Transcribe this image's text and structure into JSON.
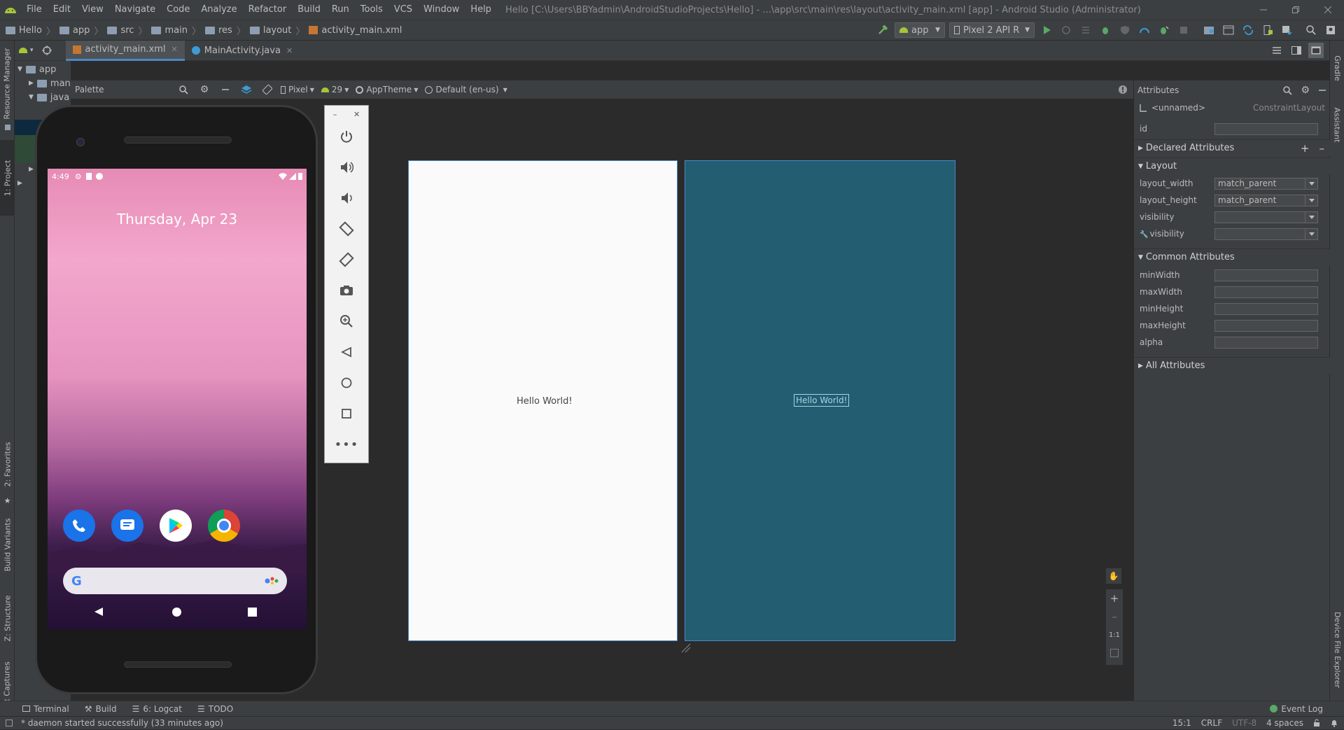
{
  "menubar": {
    "items": [
      "File",
      "Edit",
      "View",
      "Navigate",
      "Code",
      "Analyze",
      "Refactor",
      "Build",
      "Run",
      "Tools",
      "VCS",
      "Window",
      "Help"
    ],
    "title": "Hello [C:\\Users\\BBYadmin\\AndroidStudioProjects\\Hello] - ...\\app\\src\\main\\res\\layout\\activity_main.xml [app] - Android Studio (Administrator)"
  },
  "breadcrumb": [
    "Hello",
    "app",
    "src",
    "main",
    "res",
    "layout",
    "activity_main.xml"
  ],
  "toolbar": {
    "run_config": "app",
    "device": "Pixel 2 API R"
  },
  "editor_tabs": [
    {
      "label": "activity_main.xml",
      "active": true
    },
    {
      "label": "MainActivity.java",
      "active": false
    }
  ],
  "project_tree": {
    "root": "app",
    "items": [
      "man",
      "java"
    ]
  },
  "left_strip": {
    "resource_manager": "Resource Manager",
    "project": "1: Project",
    "favorites": "2: Favorites",
    "build_variants": "Build Variants",
    "structure": "Z: Structure",
    "layout_captures": "Layout Captures"
  },
  "right_strip": {
    "gradle": "Gradle",
    "assistant": "Assistant",
    "device_file_explorer": "Device File Explorer"
  },
  "design_bar": {
    "palette": "Palette",
    "device": "Pixel",
    "api": "29",
    "theme": "AppTheme",
    "locale": "Default (en-us)"
  },
  "phone": {
    "time": "4:49",
    "date": "Thursday, Apr 23"
  },
  "design": {
    "hello_text": "Hello World!",
    "hello_blueprint": "Hello World!"
  },
  "zoom": {
    "one_to_one": "1:1"
  },
  "attributes": {
    "title": "Attributes",
    "component": "<unnamed>",
    "component_type": "ConstraintLayout",
    "id_label": "id",
    "declared": "Declared Attributes",
    "layout": "Layout",
    "layout_width_label": "layout_width",
    "layout_width_value": "match_parent",
    "layout_height_label": "layout_height",
    "layout_height_value": "match_parent",
    "visibility_label": "visibility",
    "tools_visibility_label": "visibility",
    "common": "Common Attributes",
    "minWidth": "minWidth",
    "maxWidth": "maxWidth",
    "minHeight": "minHeight",
    "maxHeight": "maxHeight",
    "alpha": "alpha",
    "all": "All Attributes"
  },
  "bottom_tabs": {
    "terminal": "Terminal",
    "build": "Build",
    "logcat": "6: Logcat",
    "todo": "TODO",
    "event_log": "Event Log"
  },
  "status": {
    "message": "* daemon started successfully (33 minutes ago)",
    "position": "15:1",
    "line_sep": "CRLF",
    "encoding": "UTF-8",
    "indent": "4 spaces"
  },
  "colors": {
    "accent": "#4a88c7",
    "android_green": "#a4c639",
    "blueprint": "#235d71"
  }
}
